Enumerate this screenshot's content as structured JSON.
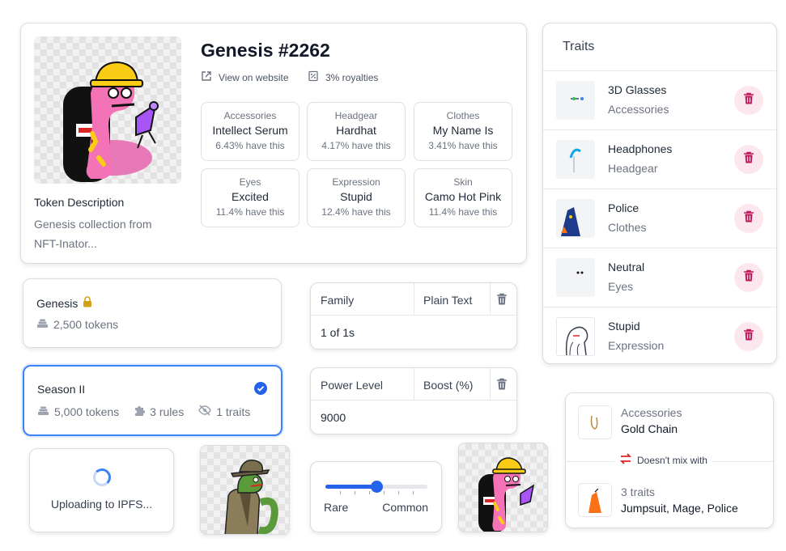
{
  "token": {
    "title": "Genesis #2262",
    "view_website": "View on website",
    "royalties": "3% royalties",
    "description_title": "Token Description",
    "description": "Genesis collection from NFT-Inator...",
    "attributes": [
      {
        "type": "Accessories",
        "value": "Intellect Serum",
        "pct": "6.43% have this"
      },
      {
        "type": "Headgear",
        "value": "Hardhat",
        "pct": "4.17% have this"
      },
      {
        "type": "Clothes",
        "value": "My Name Is",
        "pct": "3.41% have this"
      },
      {
        "type": "Eyes",
        "value": "Excited",
        "pct": "11.4% have this"
      },
      {
        "type": "Expression",
        "value": "Stupid",
        "pct": "12.4% have this"
      },
      {
        "type": "Skin",
        "value": "Camo Hot Pink",
        "pct": "11.4% have this"
      }
    ]
  },
  "traits": {
    "title": "Traits",
    "items": [
      {
        "name": "3D Glasses",
        "category": "Accessories"
      },
      {
        "name": "Headphones",
        "category": "Headgear"
      },
      {
        "name": "Police",
        "category": "Clothes"
      },
      {
        "name": "Neutral",
        "category": "Eyes"
      },
      {
        "name": "Stupid",
        "category": "Expression"
      }
    ]
  },
  "collections": [
    {
      "name": "Genesis",
      "tokens": "2,500 tokens"
    },
    {
      "name": "Season II",
      "tokens": "5,000 tokens",
      "rules": "3 rules",
      "hidden": "1 traits"
    }
  ],
  "fields": [
    {
      "key": "Family",
      "type": "Plain Text",
      "value": "1 of 1s"
    },
    {
      "key": "Power Level",
      "type": "Boost (%)",
      "value": "9000"
    }
  ],
  "upload": {
    "text": "Uploading to IPFS..."
  },
  "rarity": {
    "left": "Rare",
    "right": "Common",
    "level": 0.5
  },
  "rule": {
    "top_category": "Accessories",
    "top_value": "Gold Chain",
    "relation": "Doesn't mix with",
    "bottom_category": "3 traits",
    "bottom_value": "Jumpsuit, Mage, Police"
  },
  "colors": {
    "accent": "#2563eb",
    "danger": "#be185d",
    "lock": "#d4a017"
  }
}
